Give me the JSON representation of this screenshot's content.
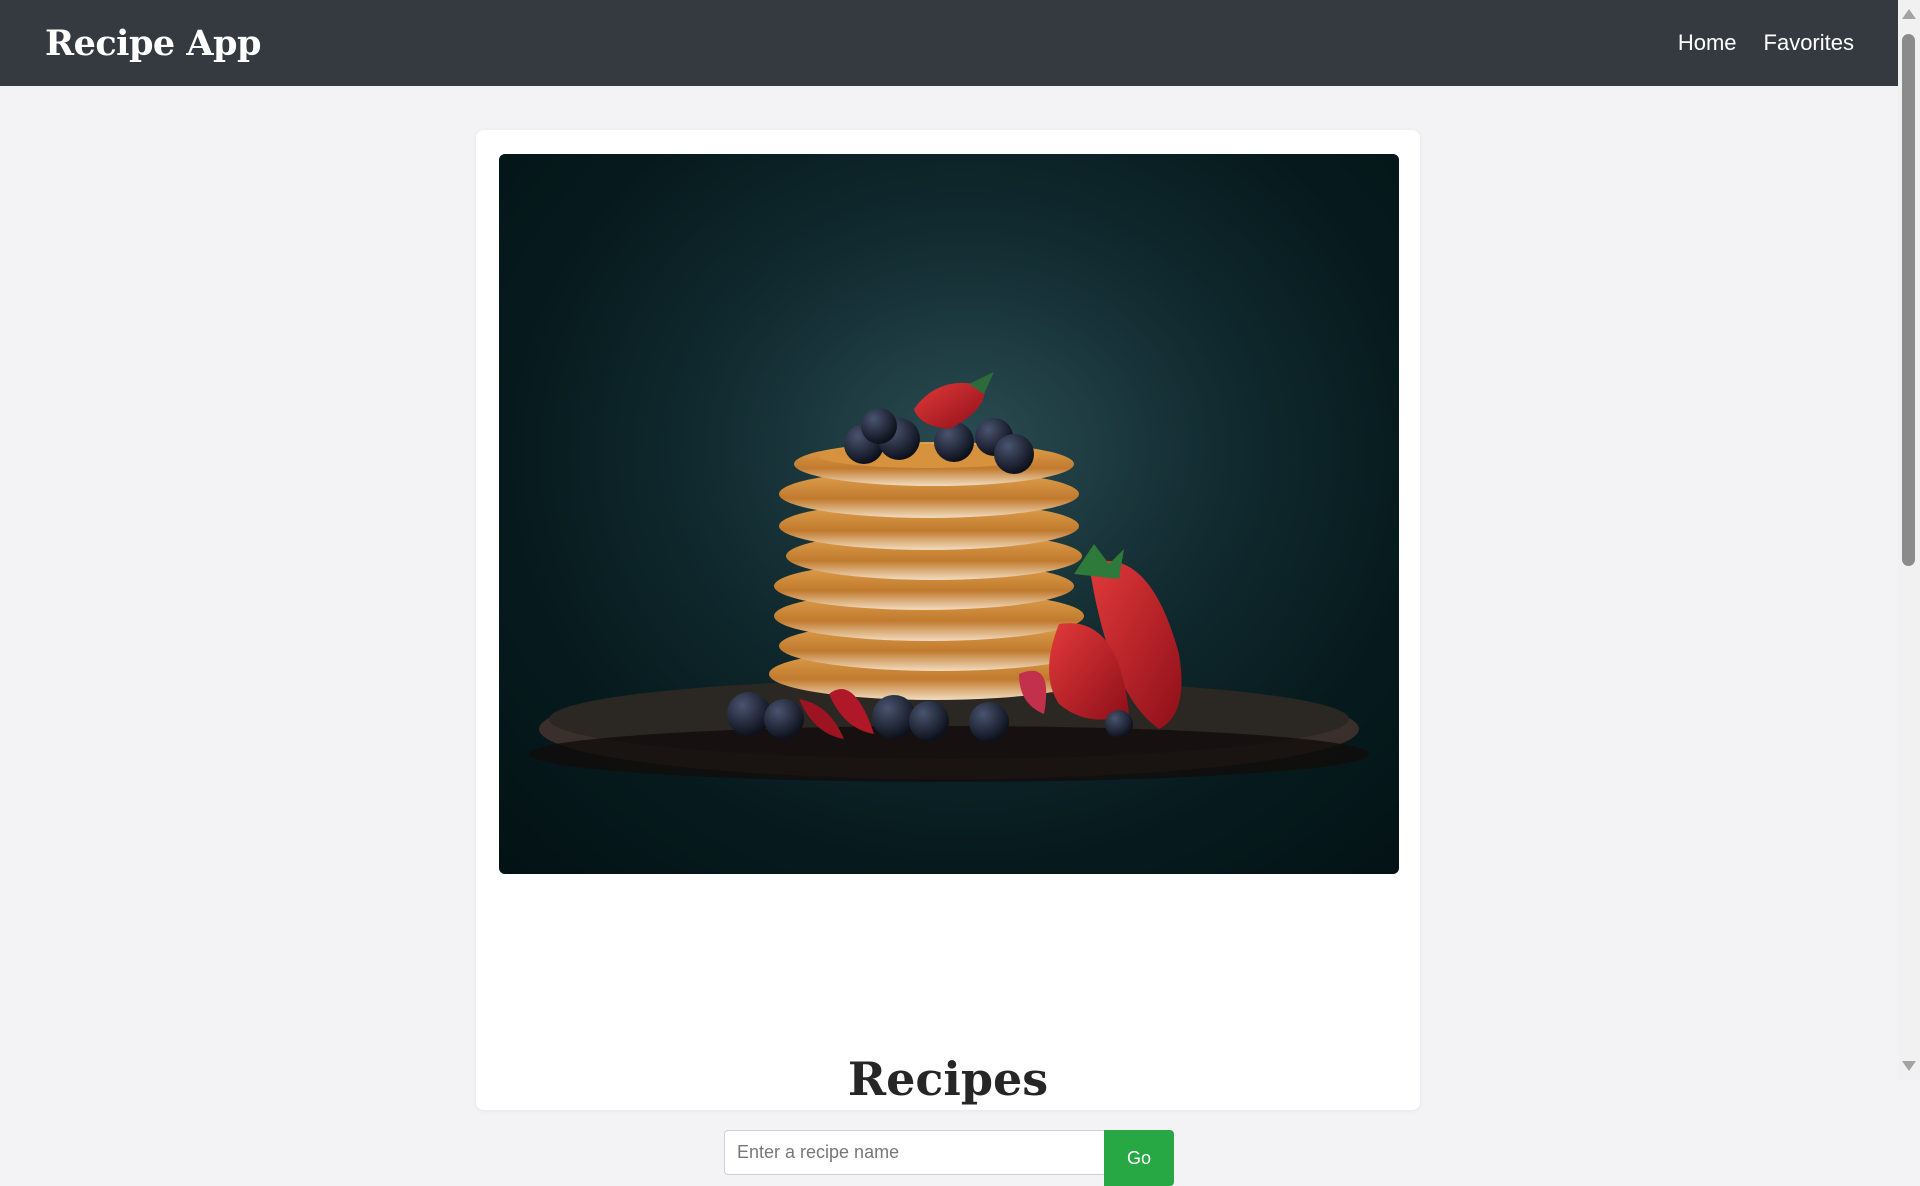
{
  "header": {
    "brand": "Recipe App",
    "nav": [
      {
        "label": "Home"
      },
      {
        "label": "Favorites"
      }
    ]
  },
  "hero": {
    "image_alt": "pancakes-photo",
    "colors": {
      "background": "#0a2226",
      "pancake": "#d9953f",
      "berry": "#151c2c",
      "strawberry": "#c8232c"
    }
  },
  "main": {
    "title": "Recipes",
    "search": {
      "placeholder": "Enter a recipe name",
      "value": "",
      "button_label": "Go"
    }
  },
  "colors": {
    "navbar": "#343a40",
    "page_background": "#f3f3f6",
    "accent": "#28a745"
  }
}
